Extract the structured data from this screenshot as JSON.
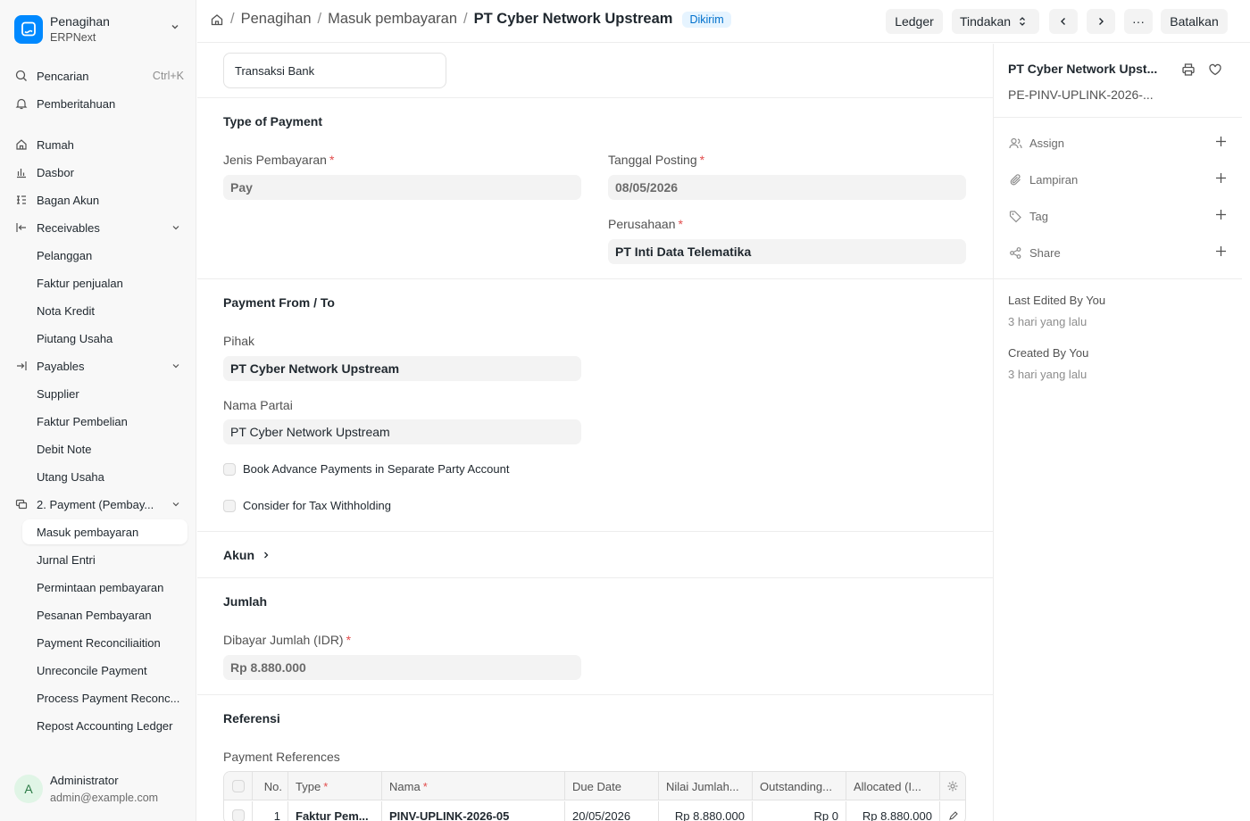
{
  "brand": {
    "title": "Penagihan",
    "subtitle": "ERPNext"
  },
  "sidebar": {
    "search": {
      "label": "Pencarian",
      "shortcut": "Ctrl+K"
    },
    "notifications": {
      "label": "Pemberitahuan"
    },
    "items": [
      {
        "label": "Rumah"
      },
      {
        "label": "Dasbor"
      },
      {
        "label": "Bagan Akun"
      },
      {
        "label": "Receivables"
      },
      {
        "label": "Pelanggan"
      },
      {
        "label": "Faktur penjualan"
      },
      {
        "label": "Nota Kredit"
      },
      {
        "label": "Piutang Usaha"
      },
      {
        "label": "Payables"
      },
      {
        "label": "Supplier"
      },
      {
        "label": "Faktur Pembelian"
      },
      {
        "label": "Debit Note"
      },
      {
        "label": "Utang Usaha"
      },
      {
        "label": "2. Payment (Pembay..."
      },
      {
        "label": "Masuk pembayaran"
      },
      {
        "label": "Jurnal Entri"
      },
      {
        "label": "Permintaan pembayaran"
      },
      {
        "label": "Pesanan Pembayaran"
      },
      {
        "label": "Payment Reconciliaition"
      },
      {
        "label": "Unreconcile Payment"
      },
      {
        "label": "Process Payment Reconc..."
      },
      {
        "label": "Repost Accounting Ledger"
      }
    ]
  },
  "user": {
    "initial": "A",
    "name": "Administrator",
    "email": "admin@example.com"
  },
  "header": {
    "breadcrumbs": [
      "Penagihan",
      "Masuk pembayaran"
    ],
    "current": "PT Cyber Network Upstream",
    "status": "Dikirim",
    "separator": "/",
    "buttons": {
      "ledger": "Ledger",
      "actions": "Tindakan",
      "more": "···",
      "cancel": "Batalkan"
    }
  },
  "form": {
    "tab": "Transaksi Bank",
    "type_of_payment": {
      "title": "Type of Payment",
      "payment_type": {
        "label": "Jenis Pembayaran",
        "value": "Pay"
      },
      "posting_date": {
        "label": "Tanggal Posting",
        "value": "08/05/2026"
      },
      "company": {
        "label": "Perusahaan",
        "value": "PT Inti Data Telematika"
      }
    },
    "party": {
      "title": "Payment From / To",
      "party": {
        "label": "Pihak",
        "value": "PT Cyber Network Upstream"
      },
      "party_name": {
        "label": "Nama Partai",
        "value": "PT Cyber Network Upstream"
      },
      "advance_check": "Book Advance Payments in Separate Party Account",
      "tax_check": "Consider for Tax Withholding"
    },
    "accounts": {
      "title": "Akun"
    },
    "amount": {
      "title": "Jumlah",
      "paid": {
        "label": "Dibayar Jumlah (IDR)",
        "value": "Rp 8.880.000"
      }
    },
    "references": {
      "title": "Referensi",
      "table_label": "Payment References",
      "columns": [
        "No.",
        "Type",
        "Nama",
        "Due Date",
        "Nilai Jumlah...",
        "Outstanding...",
        "Allocated (I..."
      ],
      "rows": [
        {
          "no": "1",
          "type": "Faktur Pem...",
          "name": "PINV-UPLINK-2026-05",
          "due_date": "20/05/2026",
          "total": "Rp 8.880.000",
          "outstanding": "Rp 0",
          "allocated": "Rp 8.880.000"
        }
      ]
    }
  },
  "right": {
    "title": "PT Cyber Network Upst...",
    "subtitle": "PE-PINV-UPLINK-2026-...",
    "actions": [
      {
        "label": "Assign"
      },
      {
        "label": "Lampiran"
      },
      {
        "label": "Tag"
      },
      {
        "label": "Share"
      }
    ],
    "last_edited": {
      "label": "Last Edited By You",
      "time": "3 hari yang lalu"
    },
    "created": {
      "label": "Created By You",
      "time": "3 hari yang lalu"
    }
  },
  "colors": {
    "accent": "#0089ff",
    "required": "#e24c4c",
    "badge_bg": "#e6f4ff",
    "badge_text": "#0070cc"
  }
}
